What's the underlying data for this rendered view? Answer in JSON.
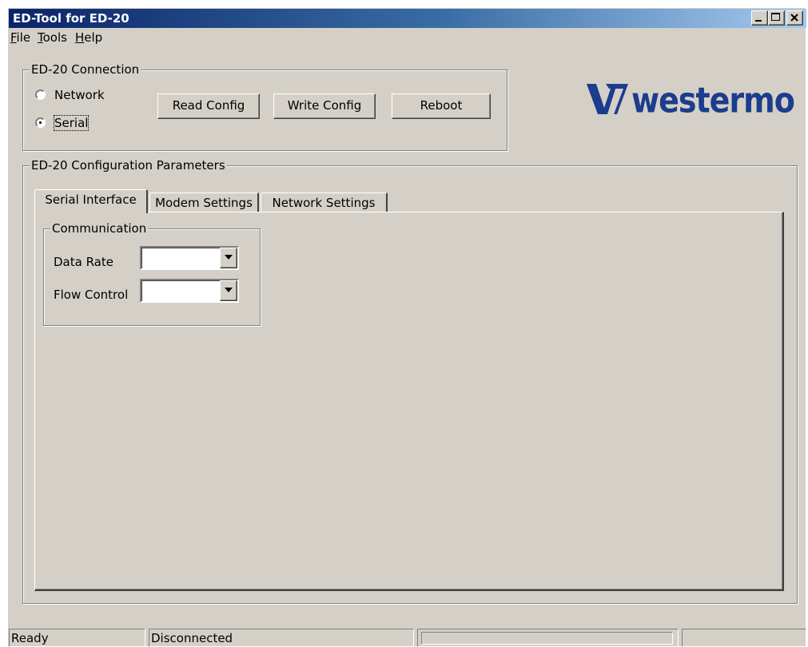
{
  "window": {
    "title": "ED-Tool for ED-20"
  },
  "menu": {
    "file": "File",
    "tools": "Tools",
    "help": "Help"
  },
  "connection": {
    "group_label": "ED-20 Connection",
    "radios": [
      {
        "label": "Network",
        "selected": false
      },
      {
        "label": "Serial",
        "selected": true
      }
    ],
    "buttons": {
      "read": "Read Config",
      "write": "Write Config",
      "reboot": "Reboot"
    }
  },
  "logo": {
    "text": "westermo",
    "color": "#1c3c8c"
  },
  "config": {
    "group_label": "ED-20 Configuration Parameters",
    "tabs": [
      {
        "label": "Serial Interface",
        "active": true
      },
      {
        "label": "Modem Settings",
        "active": false
      },
      {
        "label": "Network Settings",
        "active": false
      }
    ],
    "communication": {
      "group_label": "Communication",
      "data_rate_label": "Data Rate",
      "data_rate_value": "",
      "flow_control_label": "Flow Control",
      "flow_control_value": ""
    }
  },
  "status": {
    "left": "Ready",
    "connection": "Disconnected",
    "progress": 0
  },
  "icons": [
    "minimize-icon",
    "maximize-icon",
    "close-icon",
    "dropdown-arrow-icon",
    "westermo-logo"
  ]
}
